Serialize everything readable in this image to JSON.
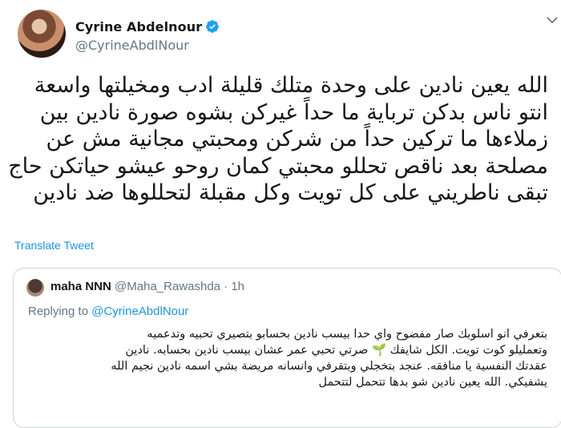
{
  "author": {
    "display_name": "Cyrine Abdelnour",
    "handle": "@CyrineAbdlNour"
  },
  "tweet": {
    "text": "الله يعين نادين على وحدة متلك قليلة ادب ومخيلتها واسعة\nانتو ناس بدكن ترباية ما حداً غيركن بشوه صورة نادين بين\nزملاءها ما تركين حداً من شركن ومحبتي مجانية مش عن\nمصلحة بعد ناقص تحللو محبتي كمان روحو عيشو حياتكن حاج\nتبقى ناطريني على كل تويت وكل مقبلة لتحللوها ضد نادين"
  },
  "translate_label": "Translate Tweet",
  "quoted": {
    "display_name": "maha NNN",
    "handle": "@Maha_Rawashda",
    "separator": "·",
    "time": "1h",
    "replying_prefix": "Replying to",
    "replying_to": "@CyrineAbdlNour",
    "text": "بتعرفي انو اسلوبك صار مفضوح واي حدا بيسب نادين بحسابو بتصيري تحبيه وتدعميه\nوتعمليلو كوت تويت. الكل شايفك 🌱 صرتي تحبي عمر عشان بيسب نادين بحسابه. نادين\nعقدتك النفسية يا منافقه. عنجد بتخجلي وبتقرفي وانسانه مريضة بشي اسمه نادين نجيم الله\nيشفيكي. الله يعين نادين شو بدها تتحمل لتتحمل"
  },
  "icons": {
    "verified": "verified-badge-icon",
    "menu": "chevron-down-icon",
    "accent": "#1da1f2"
  }
}
